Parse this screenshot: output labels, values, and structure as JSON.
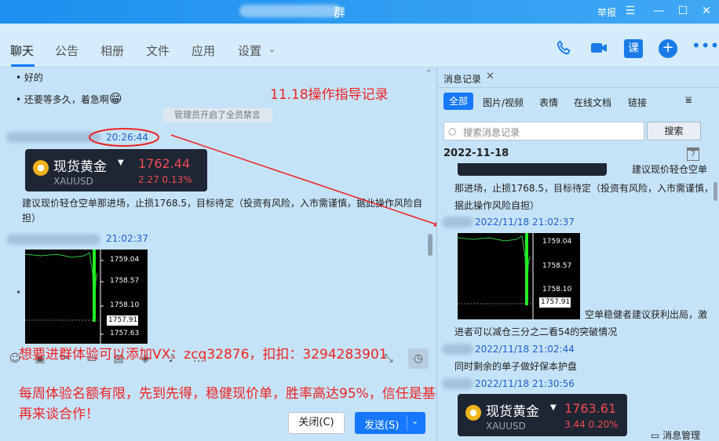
{
  "window": {
    "title_suffix": "群",
    "report": "举报",
    "controls": [
      "☰",
      "—",
      "☐",
      "✕"
    ]
  },
  "tabs": [
    "聊天",
    "公告",
    "相册",
    "文件",
    "应用",
    "设置"
  ],
  "chat": {
    "msg1": "好的",
    "msg2": "还要等多久，着急啊",
    "emoji": "😁",
    "system": "管理员开启了全员禁言",
    "time1": "20:26:44",
    "gold": {
      "name": "现货黄金",
      "symbol": "XAUUSD",
      "price": "1762.44",
      "change": "2.27",
      "pct": "0.13%"
    },
    "advice": "建议现价轻仓空单那进场，止损1768.5，目标待定（投资有风险，入市需谨慎，据此操作风险自担）",
    "time2": "21:02:37",
    "chart_prices": [
      "1759.04",
      "1758.57",
      "1758.10",
      "1757.91",
      "1757.63"
    ]
  },
  "annotations": {
    "title": "11.18操作指导记录",
    "contact": "想要进群体验可以添加VX：zcq32876，扣扣：3294283901",
    "promo": "每周体验名额有限，先到先得，稳健现价单，胜率高达95%，信任是基础，实力才是关键！张彦溱秉承先体验实力，再来谈合作！"
  },
  "buttons": {
    "close": "关闭(C)",
    "send": "发送(S)"
  },
  "panel": {
    "tab": "消息记录",
    "filters": [
      "全部",
      "图片/视频",
      "表情",
      "在线文档",
      "链接"
    ],
    "search_placeholder": "搜索消息记录",
    "search_btn": "搜索",
    "date": "2022-11-18",
    "calendar_day": "7",
    "advice_a": "建议现价轻仓空单",
    "advice_b": "那进场，止损1768.5，目标待定（投资有风险，入市需谨慎，",
    "advice_c": "据此操作风险自担）",
    "time1": "2022/11/18 21:02:37",
    "chart_prices": [
      "1759.04",
      "1758.57",
      "1758.10",
      "1757.91"
    ],
    "msg_a": "空单稳健者建议获利出局，激",
    "msg_b": "进者可以减仓三分之二看54的突破情况",
    "time2": "2022/11/18 21:02:44",
    "msg_c": "同时剩余的单子做好保本护盘",
    "time3": "2022/11/18 21:30:56",
    "gold": {
      "name": "现货黄金",
      "symbol": "XAUUSD",
      "price": "1763.61",
      "change": "3.44",
      "pct": "0.20%"
    },
    "footer": "消息管理"
  }
}
